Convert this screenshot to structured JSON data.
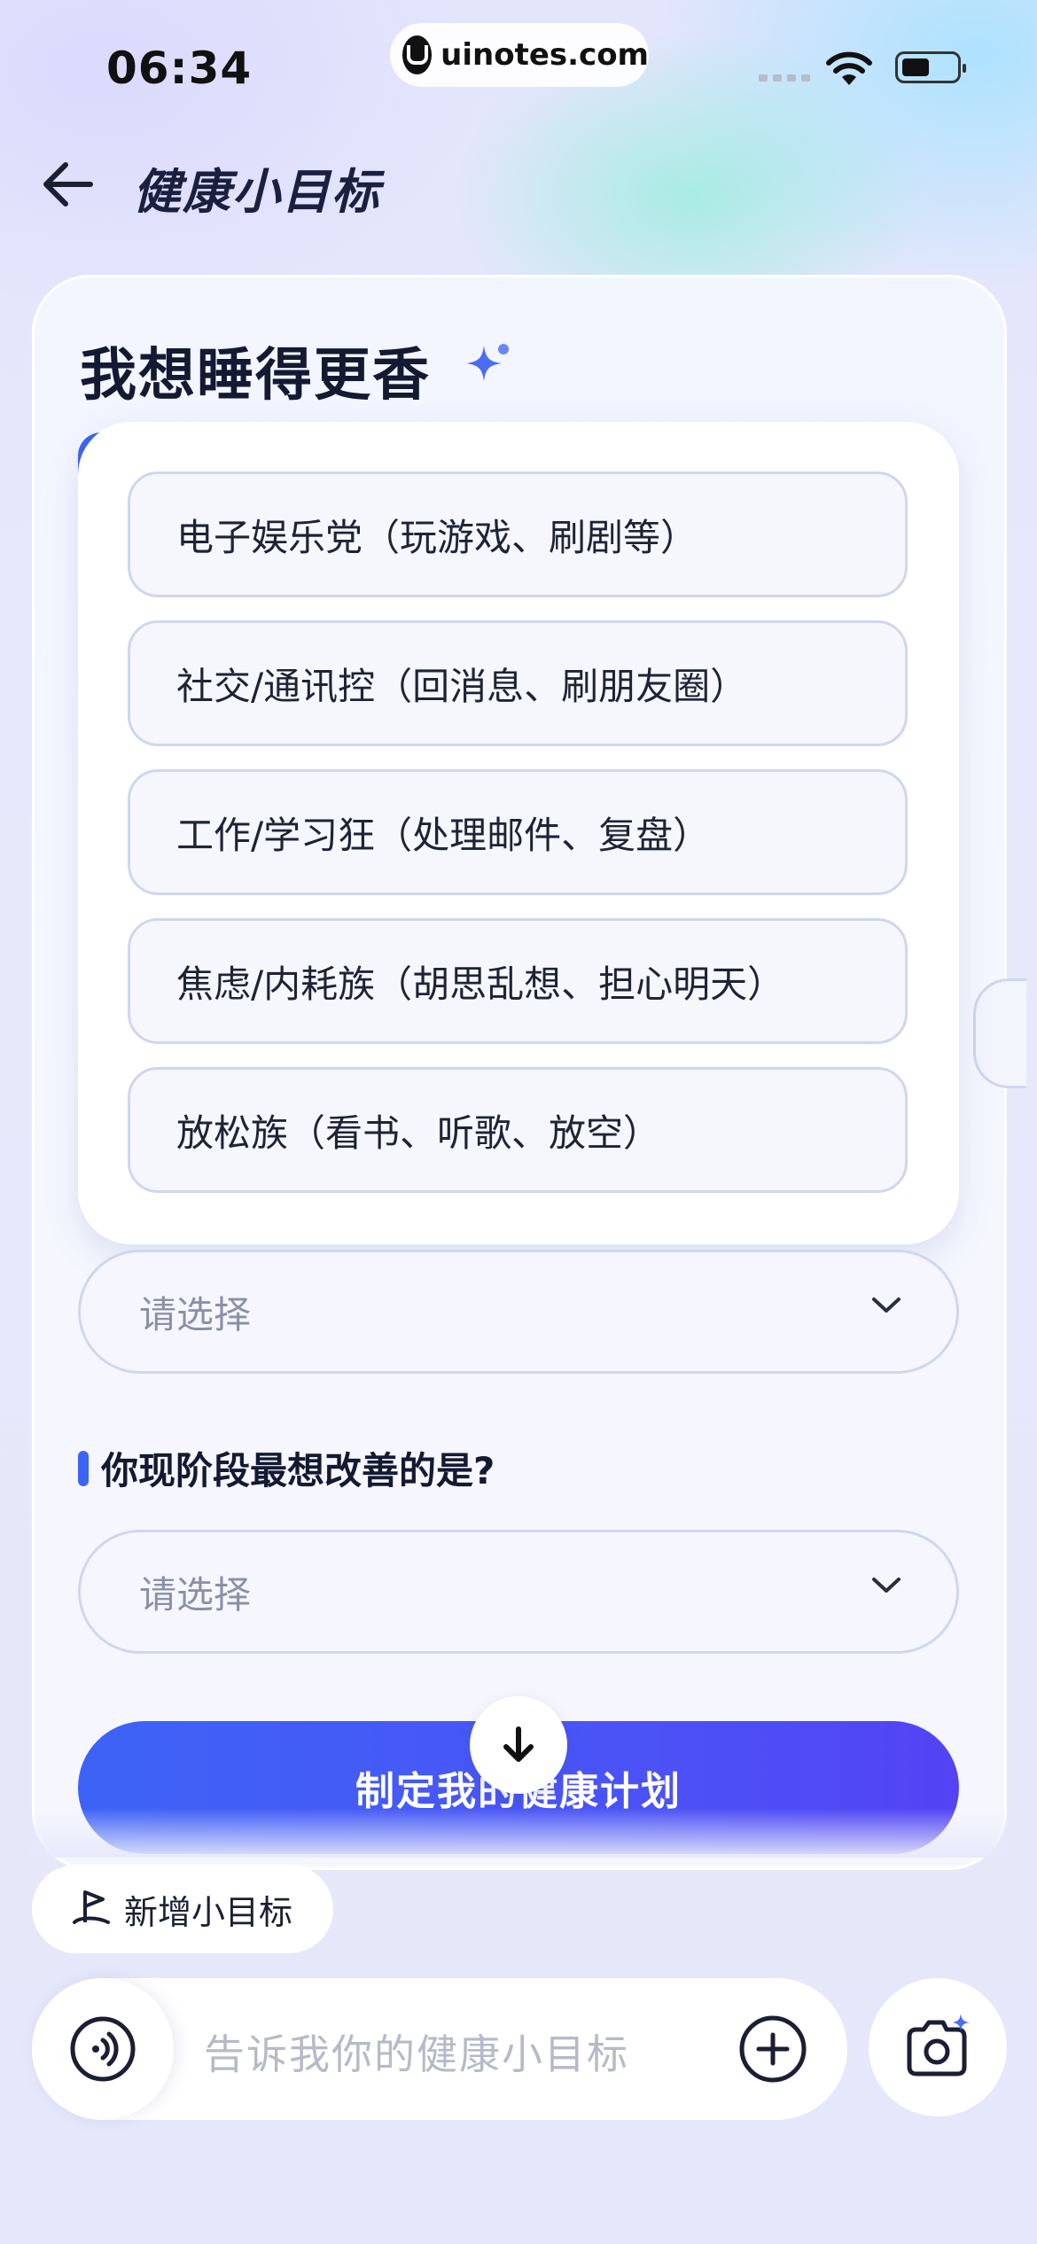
{
  "status_bar": {
    "time": "06:34",
    "url": "uinotes.com"
  },
  "header": {
    "title": "健康小目标"
  },
  "card": {
    "title": "我想睡得更香",
    "options": [
      "电子娱乐党（玩游戏、刷剧等）",
      "社交/通讯控（回消息、刷朋友圈）",
      "工作/学习狂（处理邮件、复盘）",
      "焦虑/内耗族（胡思乱想、担心明天）",
      "放松族（看书、听歌、放空）"
    ],
    "select_1": {
      "placeholder": "请选择"
    },
    "question_2": "你现阶段最想改善的是?",
    "select_2": {
      "placeholder": "请选择"
    },
    "cta_label": "制定我的健康计划"
  },
  "bottom": {
    "new_goal_label": "新增小目标",
    "input_placeholder": "告诉我你的健康小目标"
  },
  "colors": {
    "accent": "#3d63f5",
    "cta_end": "#5343f5",
    "text": "#151a33"
  }
}
